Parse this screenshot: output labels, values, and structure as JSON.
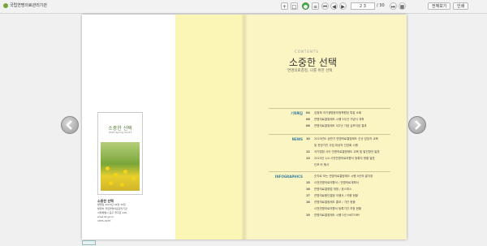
{
  "header": {
    "site": "국립연명의료관리기관",
    "page_input": "2 3",
    "total_pages": "/ 30",
    "btn_search": "전체보기",
    "btn_print": "인쇄"
  },
  "cover": {
    "title": "소중한 선택",
    "subtitle": "2023 Spring Vol.23"
  },
  "publication": {
    "title": "소중한 선택",
    "line1": "발행일  2023년 04월 30일",
    "line2": "발행처  국립연명의료관리기관",
    "line3": "서울특별시 중구 을지로 245",
    "line4": "www.lst.go.kr",
    "line5": "1855-0075"
  },
  "contents": {
    "label": "CONTENTS",
    "title": "소중한 선택",
    "subtitle": "연명의료결정, 나를 위한 선택",
    "sections": [
      {
        "name": "기획특집",
        "items": [
          {
            "page": "04",
            "text": "김정희 국가생명윤리정책원장 특집 소회"
          },
          {
            "page": "06",
            "text": "연명의료결정제도 시행 5주년 기념식 개최"
          },
          {
            "page": "08",
            "text": "연명의료결정제도 5주년 기념 심포지엄 결과"
          }
        ]
      },
      {
        "name": "NEWS",
        "items": [
          {
            "page": "10",
            "text": "2023년도 상반기 연명의료결정제도 신규 담당자 교육"
          },
          {
            "page": "",
            "text": "및 운영기관 사업 대상자 간담회 시행"
          },
          {
            "page": "12",
            "text": "국가법정 사이 연명의료결정제도 교육 및 발전방안 발표"
          },
          {
            "page": "13",
            "text": "2023년 1/4 사전연명의료의향서 등록자 현황 발표"
          },
          {
            "page": "",
            "text": "인포 타 행사"
          }
        ]
      },
      {
        "name": "INFOGRAPHICS",
        "items": [
          {
            "page": "",
            "text": "숫자로 보는 연명의료결정제도 시행 5년의 발자취"
          },
          {
            "page": "15",
            "text": "사전연명의료의향서 / 연명의료계획서"
          },
          {
            "page": "16",
            "text": "연명의료결정법 개정 / 호스피스"
          },
          {
            "page": "17",
            "text": "연명의료중단결정 이행서 / 이행 현황"
          },
          {
            "page": "18",
            "text": "연명의료결정제도 홍보 / 기관 현황"
          },
          {
            "page": "",
            "text": "사전연명의료의향서 등록기관 지정 현황"
          },
          {
            "page": "19",
            "text": "연명의료결정제도 시행 5년 HISTORY"
          }
        ]
      }
    ]
  }
}
